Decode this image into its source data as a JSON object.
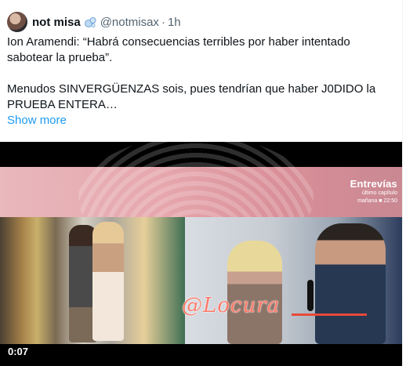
{
  "tweet": {
    "author_name": "not misa",
    "handle": "@notmisax",
    "separator": "·",
    "time": "1h",
    "text_line1": "Ion Aramendi: “Habrá consecuencias terribles por haber intentado sabotear la prueba”.",
    "text_line2": "Menudos SINVERGÜENZAS sois, pues tendrían que haber J0DIDO la PRUEBA ENTERA…",
    "show_more": "Show more"
  },
  "video": {
    "channel_logo": "Entrevías",
    "channel_sub1": "último capítulo",
    "channel_sub2": "mañana   ■   22:50",
    "watermark": "@Locura",
    "timestamp": "0:07"
  },
  "icons": {
    "badge": "bubbles-icon"
  },
  "colors": {
    "link": "#1d9bf0",
    "secondary_text": "#536471",
    "watermark": "#ff7a6a"
  }
}
